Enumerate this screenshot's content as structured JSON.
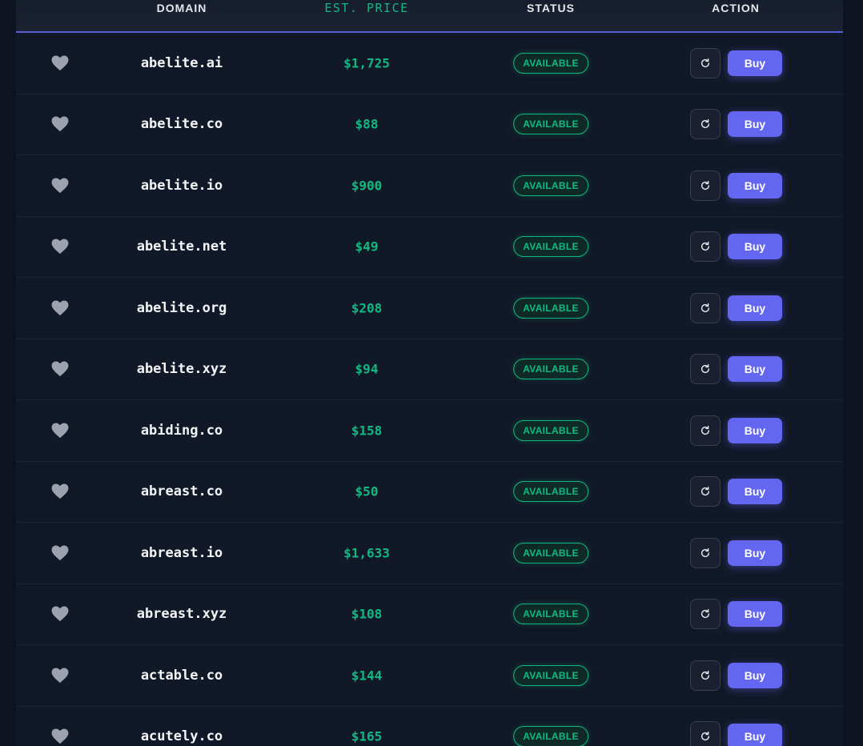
{
  "header": {
    "domain": "DOMAIN",
    "price": "EST. PRICE",
    "status": "STATUS",
    "action": "ACTION"
  },
  "colors": {
    "accent": "#6366f1",
    "price": "#10b981",
    "background": "#111827"
  },
  "icons": {
    "favorite": "heart-icon",
    "refresh": "refresh-icon"
  },
  "rows": [
    {
      "domain": "abelite.ai",
      "price": "$1,725",
      "status": "AVAILABLE",
      "buy": "Buy"
    },
    {
      "domain": "abelite.co",
      "price": "$88",
      "status": "AVAILABLE",
      "buy": "Buy"
    },
    {
      "domain": "abelite.io",
      "price": "$900",
      "status": "AVAILABLE",
      "buy": "Buy"
    },
    {
      "domain": "abelite.net",
      "price": "$49",
      "status": "AVAILABLE",
      "buy": "Buy"
    },
    {
      "domain": "abelite.org",
      "price": "$208",
      "status": "AVAILABLE",
      "buy": "Buy"
    },
    {
      "domain": "abelite.xyz",
      "price": "$94",
      "status": "AVAILABLE",
      "buy": "Buy"
    },
    {
      "domain": "abiding.co",
      "price": "$158",
      "status": "AVAILABLE",
      "buy": "Buy"
    },
    {
      "domain": "abreast.co",
      "price": "$50",
      "status": "AVAILABLE",
      "buy": "Buy"
    },
    {
      "domain": "abreast.io",
      "price": "$1,633",
      "status": "AVAILABLE",
      "buy": "Buy"
    },
    {
      "domain": "abreast.xyz",
      "price": "$108",
      "status": "AVAILABLE",
      "buy": "Buy"
    },
    {
      "domain": "actable.co",
      "price": "$144",
      "status": "AVAILABLE",
      "buy": "Buy"
    },
    {
      "domain": "acutely.co",
      "price": "$165",
      "status": "AVAILABLE",
      "buy": "Buy"
    }
  ]
}
